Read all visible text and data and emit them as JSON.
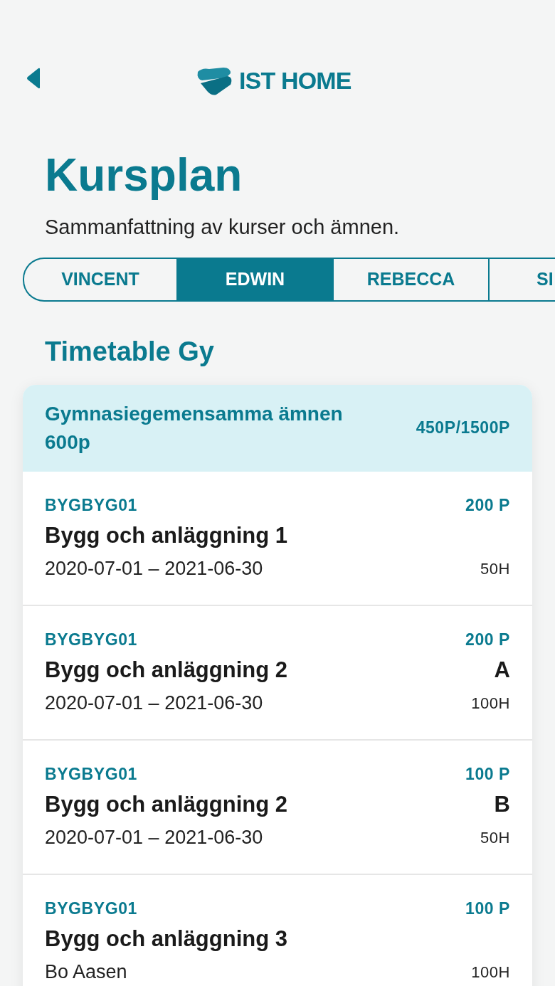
{
  "header": {
    "logo_text": "IST HOME"
  },
  "title": "Kursplan",
  "subtitle": "Sammanfattning av kurser och ämnen.",
  "tabs": [
    {
      "label": "VINCENT",
      "selected": false
    },
    {
      "label": "EDWIN",
      "selected": true
    },
    {
      "label": "REBECCA",
      "selected": false
    },
    {
      "label": "SI",
      "selected": false
    }
  ],
  "section_title": "Timetable Gy",
  "group": {
    "title": "Gymnasiegemensamma ämnen 600p",
    "points": "450P/1500P"
  },
  "courses": [
    {
      "code": "BYGBYG01",
      "points": "200 P",
      "name": "Bygg och anläggning 1",
      "detail": "2020-07-01 – 2021-06-30",
      "hours": "50H"
    },
    {
      "code": "BYGBYG01",
      "points": "200 P",
      "name": "Bygg och anläggning 2",
      "grade": "A",
      "detail": "2020-07-01 – 2021-06-30",
      "hours": "100H"
    },
    {
      "code": "BYGBYG01",
      "points": "100 P",
      "name": "Bygg och anläggning 2",
      "grade": "B",
      "detail": "2020-07-01 – 2021-06-30",
      "hours": "50H"
    },
    {
      "code": "BYGBYG01",
      "points": "100 P",
      "name": "Bygg och anläggning 3",
      "detail": "Bo Aasen",
      "hours": "100H"
    }
  ]
}
